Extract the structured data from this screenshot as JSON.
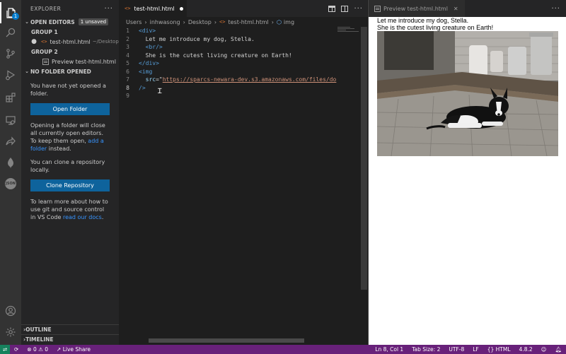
{
  "activity_bar": {
    "explorer_badge": "1",
    "items": [
      "files-icon",
      "search-icon",
      "source-control-icon",
      "run-debug-icon",
      "extensions-icon",
      "remote-explorer-icon",
      "live-share-icon",
      "mongodb-icon",
      "json-icon"
    ],
    "json_label": "JSON"
  },
  "sidebar": {
    "title": "EXPLORER",
    "open_editors": {
      "label": "OPEN EDITORS",
      "badge": "1 unsaved",
      "group1": "GROUP 1",
      "file1_name": "test-html.html",
      "file1_path": "~/Desktop",
      "group2": "GROUP 2",
      "file2_name": "Preview test-html.html"
    },
    "no_folder": {
      "label": "NO FOLDER OPENED",
      "msg1": "You have not yet opened a folder.",
      "open_folder_button": "Open Folder",
      "msg2_part1": "Opening a folder will close all currently open editors. To keep them open, ",
      "msg2_link": "add a folder",
      "msg2_part2": " instead.",
      "msg3": "You can clone a repository locally.",
      "clone_button": "Clone Repository",
      "msg4_part1": "To learn more about how to use git and source control in VS Code ",
      "msg4_link": "read our docs",
      "msg4_part2": "."
    },
    "outline": "OUTLINE",
    "timeline": "TIMELINE"
  },
  "editor": {
    "tab_label": "test-html.html",
    "breadcrumb": [
      "Users",
      "inhwasong",
      "Desktop",
      "test-html.html",
      "img"
    ],
    "lines": [
      {
        "n": "1",
        "parts": [
          {
            "c": "tag",
            "t": "<div>"
          }
        ]
      },
      {
        "n": "2",
        "parts": [
          {
            "c": "txt",
            "t": "  Let me introduce my dog, Stella."
          }
        ]
      },
      {
        "n": "3",
        "parts": [
          {
            "c": "tag",
            "t": "  <br/>"
          }
        ]
      },
      {
        "n": "4",
        "parts": [
          {
            "c": "txt",
            "t": "  She is the cutest living creature on Earth!"
          }
        ]
      },
      {
        "n": "5",
        "parts": [
          {
            "c": "tag",
            "t": "</div>"
          }
        ]
      },
      {
        "n": "6",
        "parts": [
          {
            "c": "tag",
            "t": "<img"
          }
        ]
      },
      {
        "n": "7",
        "parts": [
          {
            "c": "attr",
            "t": "  src"
          },
          {
            "c": "txt",
            "t": "=\""
          },
          {
            "c": "str",
            "t": "https://sparcs-newara-dev.s3.amazonaws.com/files/do"
          }
        ]
      },
      {
        "n": "8",
        "parts": [
          {
            "c": "tag",
            "t": "/>"
          }
        ]
      },
      {
        "n": "9",
        "parts": []
      }
    ]
  },
  "preview": {
    "tab_label": "Preview test-html.html",
    "line1": "Let me introduce my dog, Stella.",
    "line2": "She is the cutest living creature on Earth!"
  },
  "status_bar": {
    "errors": "0",
    "warnings": "0",
    "live_share": "Live Share",
    "position": "Ln 8, Col 1",
    "tab_size": "Tab Size: 2",
    "encoding": "UTF-8",
    "eol": "LF",
    "language": "HTML",
    "version": "4.8.2"
  },
  "colors": {
    "status_bar": "#68217a",
    "button": "#0e639c",
    "accent": "#007acc"
  }
}
